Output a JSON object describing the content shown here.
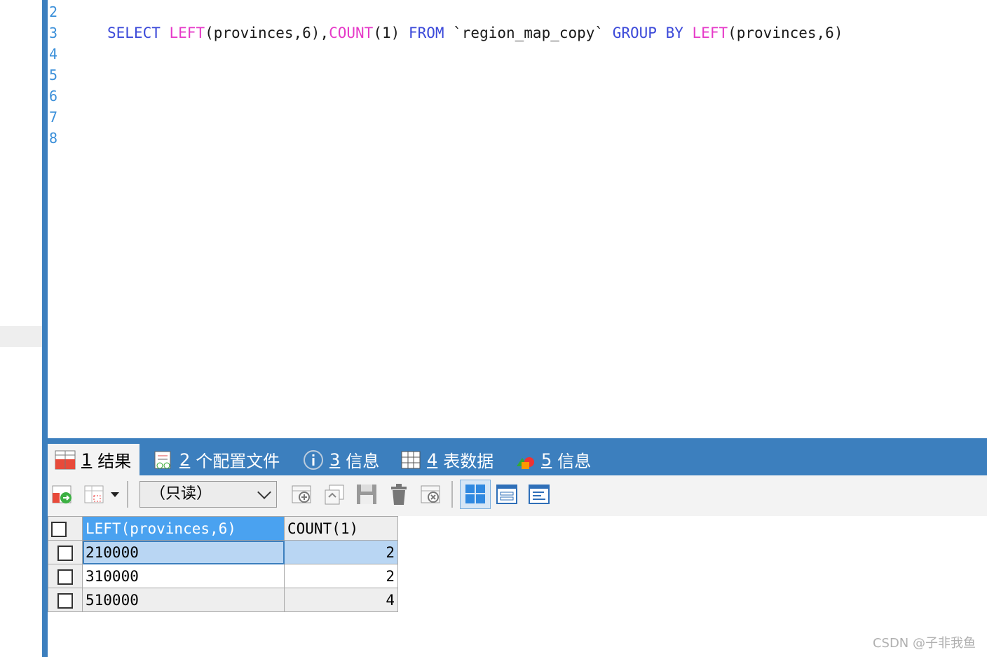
{
  "editor": {
    "lines": [
      {
        "num": "2",
        "tokens": []
      },
      {
        "num": "3",
        "tokens": [
          {
            "t": "SELECT",
            "c": "kw"
          },
          {
            "t": " ",
            "c": "tx"
          },
          {
            "t": "LEFT",
            "c": "fn"
          },
          {
            "t": "(provinces,6),",
            "c": "tx"
          },
          {
            "t": "COUNT",
            "c": "fn"
          },
          {
            "t": "(1)",
            "c": "tx"
          },
          {
            "t": " ",
            "c": "tx"
          },
          {
            "t": "FROM",
            "c": "kw"
          },
          {
            "t": " `region_map_copy` ",
            "c": "tx"
          },
          {
            "t": "GROUP BY",
            "c": "kw"
          },
          {
            "t": " ",
            "c": "tx"
          },
          {
            "t": "LEFT",
            "c": "fn"
          },
          {
            "t": "(provinces,6)",
            "c": "tx"
          }
        ]
      },
      {
        "num": "4",
        "tokens": []
      },
      {
        "num": "5",
        "tokens": []
      },
      {
        "num": "6",
        "tokens": []
      },
      {
        "num": "7",
        "tokens": []
      },
      {
        "num": "8",
        "tokens": []
      }
    ]
  },
  "tabs": [
    {
      "num": "1",
      "label": "结果",
      "icon": "result-grid-icon",
      "active": true
    },
    {
      "num": "2",
      "label": "个配置文件",
      "icon": "profile-icon",
      "active": false
    },
    {
      "num": "3",
      "label": "信息",
      "icon": "info-icon",
      "active": false
    },
    {
      "num": "4",
      "label": "表数据",
      "icon": "table-data-icon",
      "active": false
    },
    {
      "num": "5",
      "label": "信息",
      "icon": "info-shapes-icon",
      "active": false
    }
  ],
  "toolbar": {
    "readonly_label": "（只读）"
  },
  "grid": {
    "columns": [
      "LEFT(provinces,6)",
      "COUNT(1)"
    ],
    "rows": [
      [
        "210000",
        "2"
      ],
      [
        "310000",
        "2"
      ],
      [
        "510000",
        "4"
      ]
    ]
  },
  "watermark": "CSDN @子非我鱼",
  "colors": {
    "accent": "#3c7fbe",
    "keyword": "#3b49d9",
    "function": "#e63ac8",
    "line_number": "#3a8fd9"
  }
}
